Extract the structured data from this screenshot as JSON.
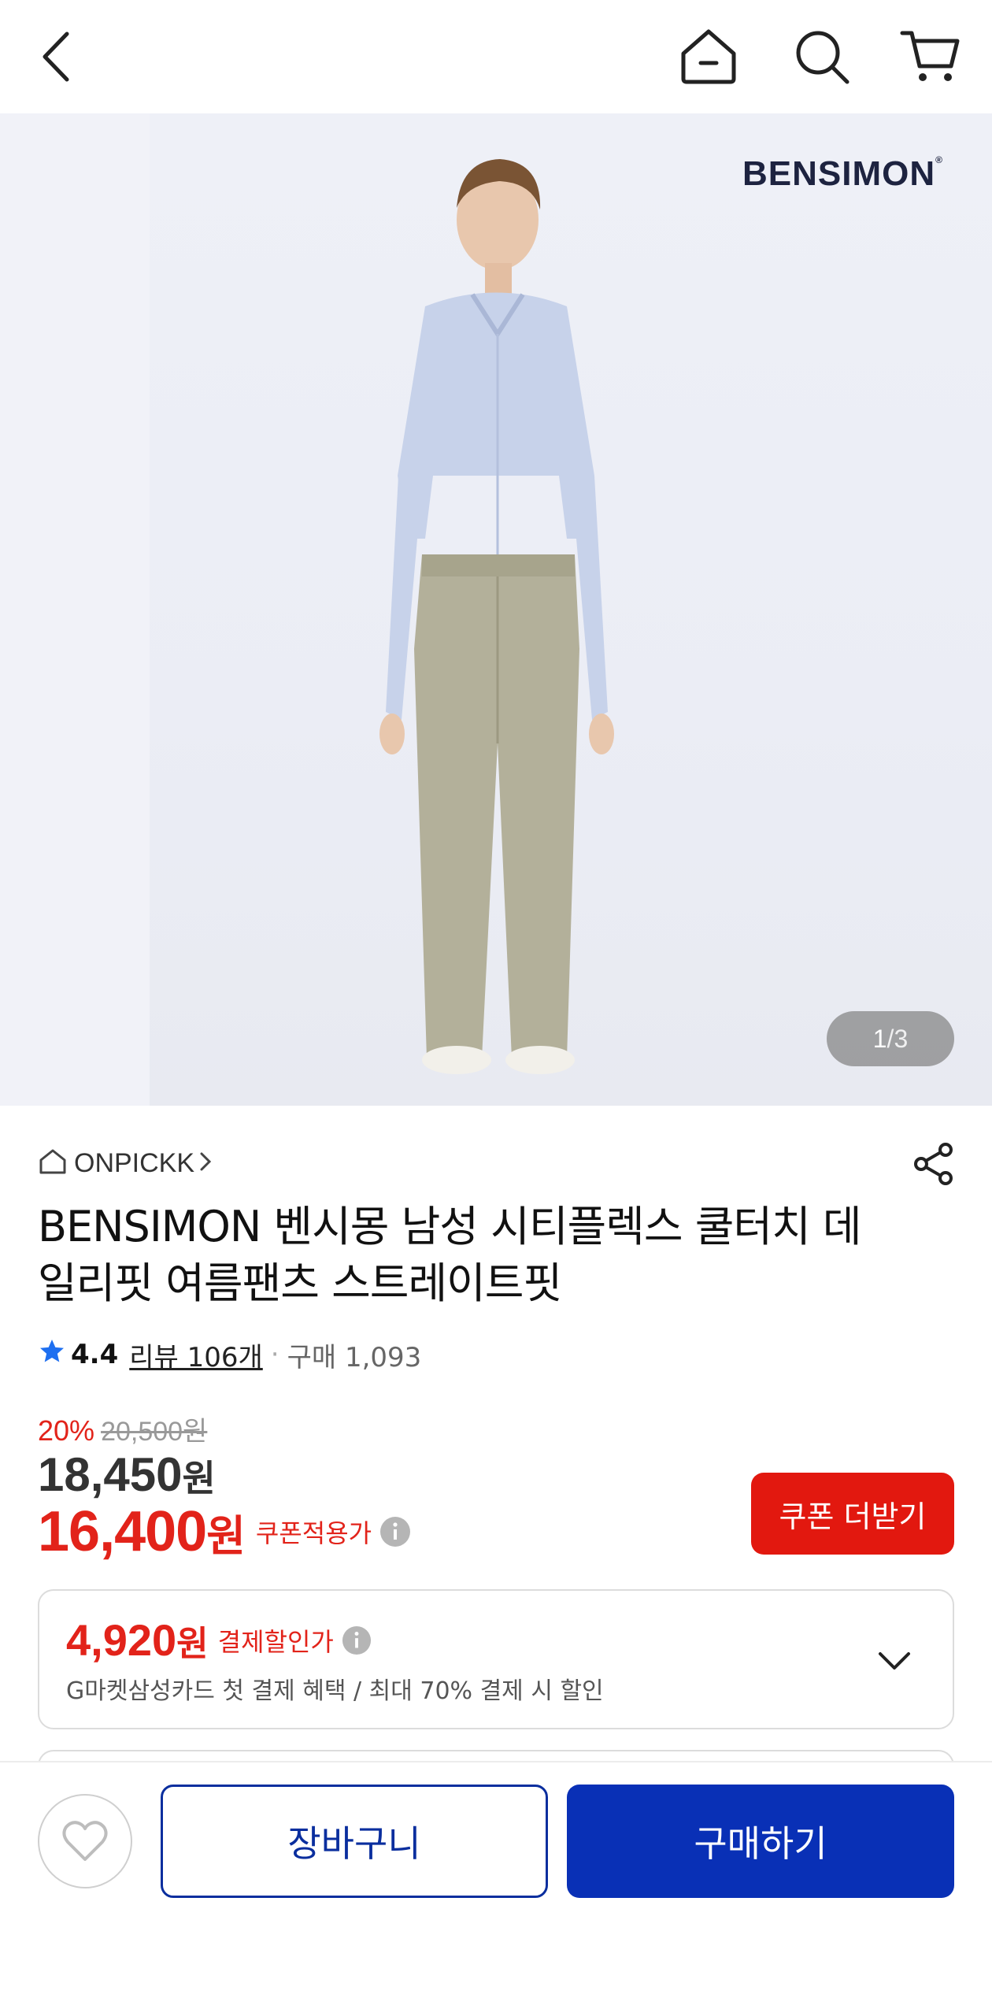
{
  "nav": {
    "back_icon": "back-chevron-icon",
    "home_icon": "home-icon",
    "search_icon": "search-icon",
    "cart_icon": "cart-icon"
  },
  "gallery": {
    "brand_logo": "BENSIMON",
    "current": "1",
    "total": "3"
  },
  "seller": {
    "name": "ONPICKK"
  },
  "product": {
    "title": "BENSIMON 벤시몽 남성 시티플렉스 쿨터치 데일리핏 여름팬츠 스트레이트핏",
    "rating": "4.4",
    "review_text": "리뷰 106개",
    "purchase_text": "구매 1,093"
  },
  "price": {
    "discount_pct": "20%",
    "original": "20,500원",
    "sale_amount": "18,450",
    "sale_won": "원",
    "coupon_amount": "16,400",
    "coupon_won": "원",
    "coupon_label": "쿠폰적용가",
    "coupon_button": "쿠폰 더받기"
  },
  "benefit": {
    "amount": "4,920",
    "won": "원",
    "label": "결제할인가",
    "desc": "G마켓삼성카드 첫 결제 혜택 / 최대 70% 결제 시 할인"
  },
  "bottom": {
    "cart_label": "장바구니",
    "buy_label": "구매하기"
  },
  "colors": {
    "accent_red": "#e2231a",
    "primary_blue": "#0930b6",
    "rating_star": "#1e6ff0"
  }
}
